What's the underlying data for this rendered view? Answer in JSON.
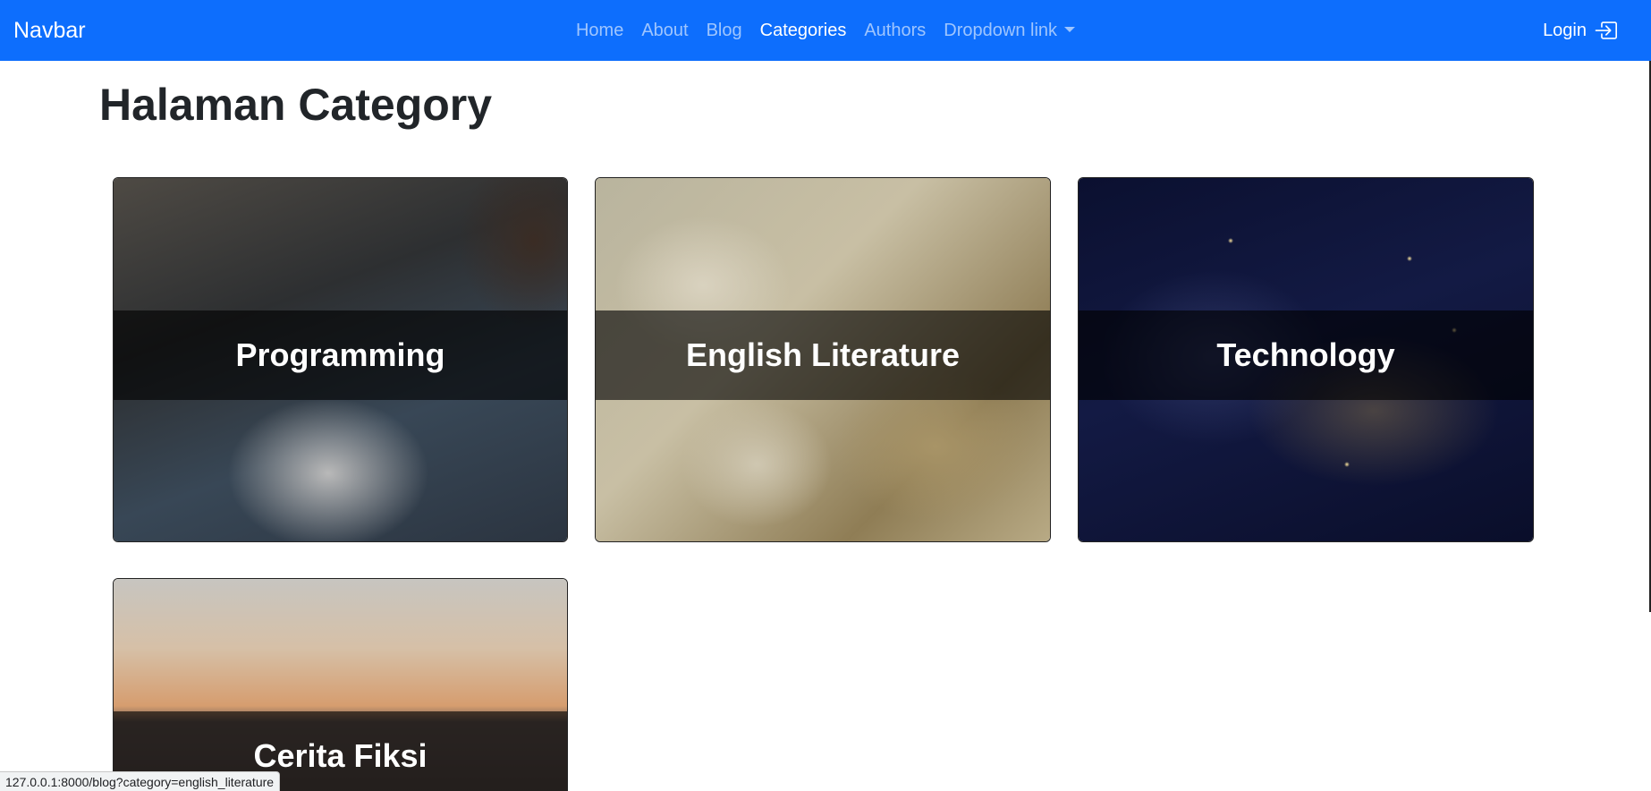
{
  "navbar": {
    "brand": "Navbar",
    "links": [
      {
        "label": "Home",
        "active": false
      },
      {
        "label": "About",
        "active": false
      },
      {
        "label": "Blog",
        "active": false
      },
      {
        "label": "Categories",
        "active": true
      },
      {
        "label": "Authors",
        "active": false
      },
      {
        "label": "Dropdown link",
        "active": false
      }
    ],
    "login_label": "Login",
    "background_color": "#0d6efd"
  },
  "main": {
    "title": "Halaman Category",
    "categories": [
      {
        "name": "Programming"
      },
      {
        "name": "English Literature"
      },
      {
        "name": "Technology"
      },
      {
        "name": "Cerita Fiksi"
      }
    ]
  },
  "status_bar": {
    "url": "127.0.0.1:8000/blog?category=english_literature"
  },
  "icons": {
    "login": "box-arrow-in-right-icon",
    "dropdown": "caret-down-icon"
  }
}
